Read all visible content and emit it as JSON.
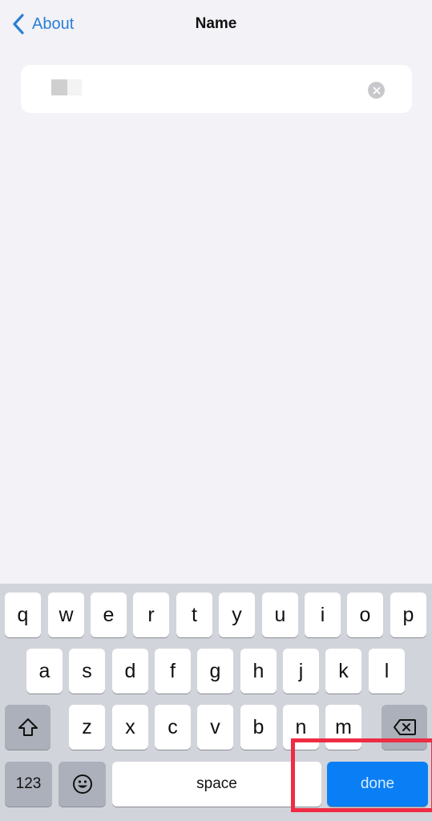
{
  "navbar": {
    "back_label": "About",
    "back_icon": "chevron-left-icon",
    "title": "Name"
  },
  "name_field": {
    "value": "",
    "value_redacted": true,
    "clear_icon": "clear-circle-icon"
  },
  "keyboard": {
    "row1": [
      "q",
      "w",
      "e",
      "r",
      "t",
      "y",
      "u",
      "i",
      "o",
      "p"
    ],
    "row2": [
      "a",
      "s",
      "d",
      "f",
      "g",
      "h",
      "j",
      "k",
      "l"
    ],
    "row3": [
      "z",
      "x",
      "c",
      "v",
      "b",
      "n",
      "m"
    ],
    "shift_icon": "shift-icon",
    "delete_icon": "delete-backspace-icon",
    "numbers_label": "123",
    "emoji_icon": "emoji-icon",
    "space_label": "space",
    "done_label": "done"
  },
  "annotation": {
    "highlight_target": "done",
    "color": "#ee2c44"
  },
  "colors": {
    "accent": "#2a7fd4",
    "done_key": "#0a7ff5",
    "background": "#f2f2f7",
    "keyboard_bg": "#d1d4db"
  }
}
